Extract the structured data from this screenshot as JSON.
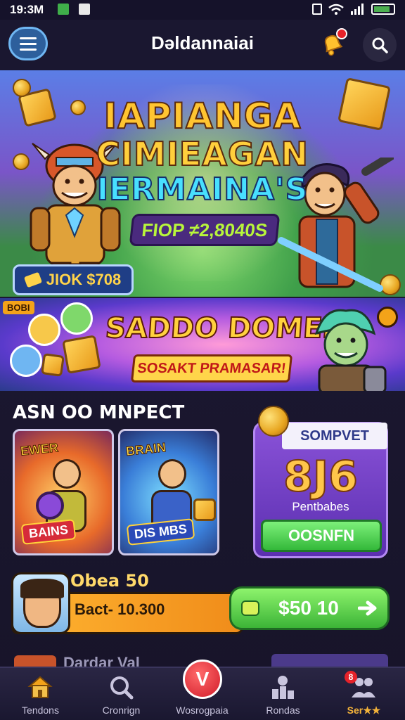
{
  "status_bar": {
    "time": "19:3M"
  },
  "header": {
    "title": "Dəldannaiai"
  },
  "hero": {
    "title_line1": "IAPIANGA",
    "title_line2": "CIMIEAGAN",
    "title_line3": "IERMAINA'S",
    "prize_text": "FIOP ≠2,8040S",
    "chip_text": "JIOK $708"
  },
  "promo": {
    "tag": "BOBI",
    "title": "SADDO DOMEFI!",
    "subtitle": "SOSAKT PRAMASAR!"
  },
  "section": {
    "title": "ASN OO MNPECT",
    "cards": [
      {
        "label": "EWER",
        "badge": "BAINS"
      },
      {
        "label": "BRAIN",
        "badge": "DIS MBS"
      }
    ]
  },
  "reward": {
    "ribbon": "SOMPVET",
    "value": "8J6",
    "label": "Pentbabes",
    "button": "OOSNFN"
  },
  "offer": {
    "label": "Obea 50",
    "price": "Bact- 10.300",
    "button": "$50 10"
  },
  "peek": {
    "label": "Dardar Val"
  },
  "bottom_nav": [
    {
      "label": "Tendons",
      "icon": "home-icon"
    },
    {
      "label": "Cronrign",
      "icon": "search-icon"
    },
    {
      "label": "Wosrogpaia",
      "icon": "play-logo-icon",
      "active_glyph": "V"
    },
    {
      "label": "Rondas",
      "icon": "leaderboard-icon"
    },
    {
      "label": "Ser★★",
      "icon": "friends-icon",
      "badge": "8"
    }
  ],
  "colors": {
    "accent_green": "#3cb437",
    "accent_purple": "#5b2fb0",
    "accent_gold": "#ffc64a",
    "alert_red": "#e6222a"
  }
}
